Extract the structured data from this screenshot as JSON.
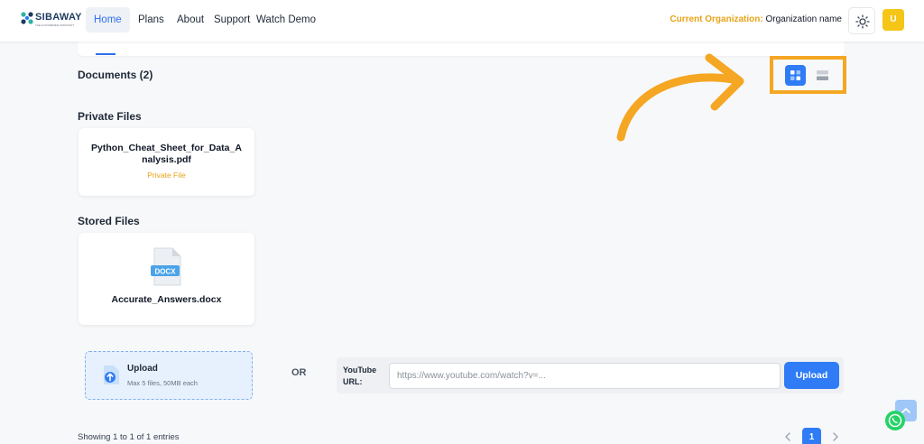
{
  "header": {
    "logo_text": "SIBAWAY",
    "logo_tagline": "THE AI-POWERED ASSISTANT",
    "nav": [
      "Home",
      "Plans",
      "About",
      "Support",
      "Watch Demo"
    ],
    "org_label": "Current Organization:",
    "org_name": "Organization name",
    "avatar_initial": "U",
    "theme_icon": "sun-icon"
  },
  "documents": {
    "title": "Documents (2)",
    "view_modes": [
      "grid-view-icon",
      "list-view-icon"
    ],
    "active_view": "grid"
  },
  "private_files": {
    "heading": "Private Files",
    "items": [
      {
        "name": "Python_Cheat_Sheet_for_Data_Analysis.pdf",
        "tag": "Private File"
      }
    ]
  },
  "stored_files": {
    "heading": "Stored Files",
    "items": [
      {
        "name": "Accurate_Answers.docx",
        "icon_label": "DOCX"
      }
    ]
  },
  "upload": {
    "title": "Upload",
    "subtitle": "Max 5 files, 50MB each",
    "or_text": "OR",
    "youtube_label": "YouTube URL:",
    "youtube_placeholder": "https://www.youtube.com/watch?v=...",
    "button_label": "Upload"
  },
  "footer": {
    "showing_text": "Showing 1 to 1 of 1 entries",
    "current_page": "1"
  },
  "colors": {
    "accent": "#2f7cf6",
    "highlight": "#f5a623",
    "org_label": "#e8a317"
  }
}
